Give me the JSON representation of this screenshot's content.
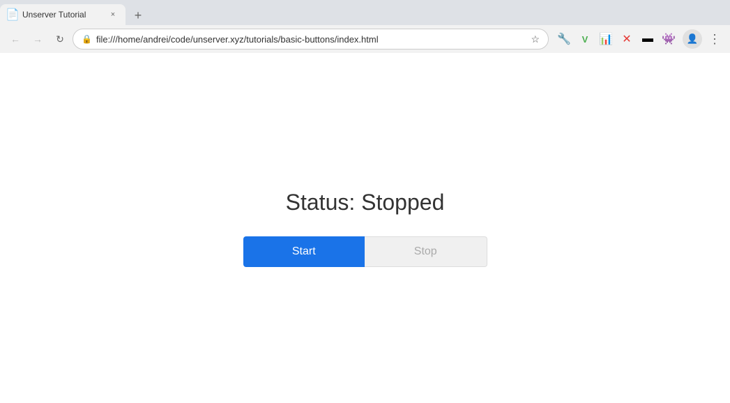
{
  "browser": {
    "tab": {
      "title": "Unserver Tutorial",
      "favicon": "📄",
      "close_label": "×"
    },
    "nav": {
      "back_label": "←",
      "forward_label": "→",
      "reload_label": "↻",
      "address": "file:///home/andrei/code/unserver.xyz/tutorials/basic-buttons/index.html",
      "star_label": "☆",
      "menu_label": "⋮"
    },
    "extensions": {
      "ext1": "🔧",
      "ext2": "V",
      "ext3": "📊",
      "ext4": "🔴",
      "ext5": "▬",
      "ext6": "👾"
    }
  },
  "page": {
    "status_label": "Status: Stopped",
    "start_button_label": "Start",
    "stop_button_label": "Stop"
  }
}
